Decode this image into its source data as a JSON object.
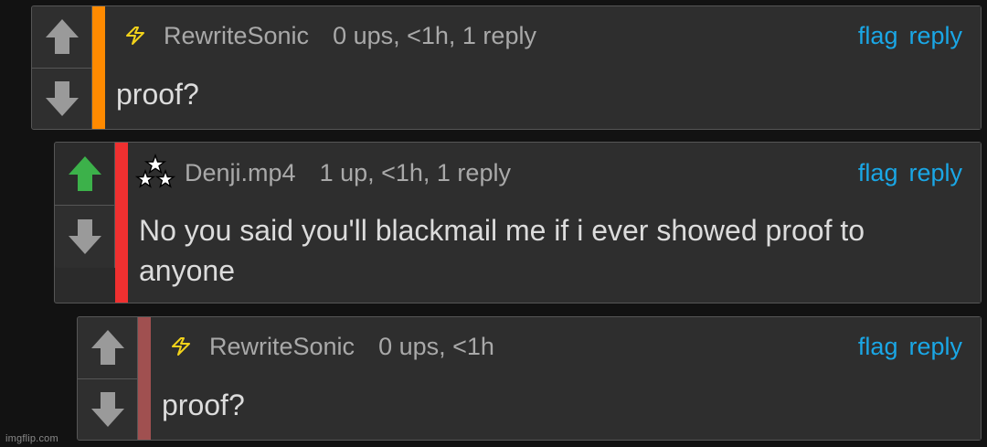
{
  "comments": [
    {
      "user": "RewriteSonic",
      "badge": "lightning-icon",
      "meta": "0 ups, <1h, 1 reply",
      "text": "proof?",
      "bar_color": "#ff8a00",
      "upvoted": false,
      "flag_label": "flag",
      "reply_label": "reply"
    },
    {
      "user": "Denji.mp4",
      "badge": "stars-icon",
      "meta": "1 up, <1h, 1 reply",
      "text": "No you said you'll blackmail me if i ever showed proof to anyone",
      "bar_color": "#f03030",
      "upvoted": true,
      "flag_label": "flag",
      "reply_label": "reply"
    },
    {
      "user": "RewriteSonic",
      "badge": "lightning-icon",
      "meta": "0 ups, <1h",
      "text": "proof?",
      "bar_color": "#a05050",
      "upvoted": false,
      "flag_label": "flag",
      "reply_label": "reply"
    }
  ],
  "watermark": "imgflip.com",
  "colors": {
    "link": "#1aa7e6",
    "upvote_active": "#3cb14a",
    "arrow_inactive": "#9a9a9a"
  }
}
